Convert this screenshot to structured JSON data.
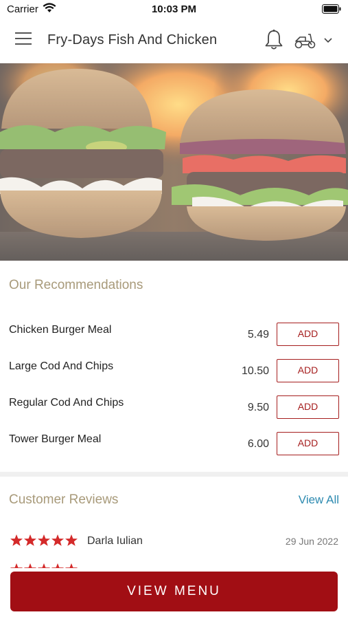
{
  "status_bar": {
    "carrier": "Carrier",
    "time": "10:03 PM"
  },
  "header": {
    "title": "Fry-Days Fish And Chicken",
    "icons": [
      "menu-icon",
      "bell-icon",
      "scooter-icon",
      "chevron-down-icon"
    ]
  },
  "hero": {
    "image": "burger-photo"
  },
  "recommendations": {
    "title": "Our Recommendations",
    "items": [
      {
        "name": "Chicken Burger Meal",
        "price": "5.49",
        "button": "ADD"
      },
      {
        "name": "Large Cod And Chips",
        "price": "10.50",
        "button": "ADD"
      },
      {
        "name": "Regular Cod And Chips",
        "price": "9.50",
        "button": "ADD"
      },
      {
        "name": "Tower Burger Meal",
        "price": "6.00",
        "button": "ADD"
      }
    ]
  },
  "reviews": {
    "title": "Customer Reviews",
    "view_all": "View All",
    "items": [
      {
        "name": "Darla Iulian",
        "date": "29 Jun 2022",
        "rating": 5
      }
    ]
  },
  "footer": {
    "view_menu": "VIEW MENU"
  },
  "colors": {
    "accent": "#a10e14",
    "section_title": "#a89a7a",
    "link": "#2d8ab0",
    "star": "#d42a2a"
  }
}
